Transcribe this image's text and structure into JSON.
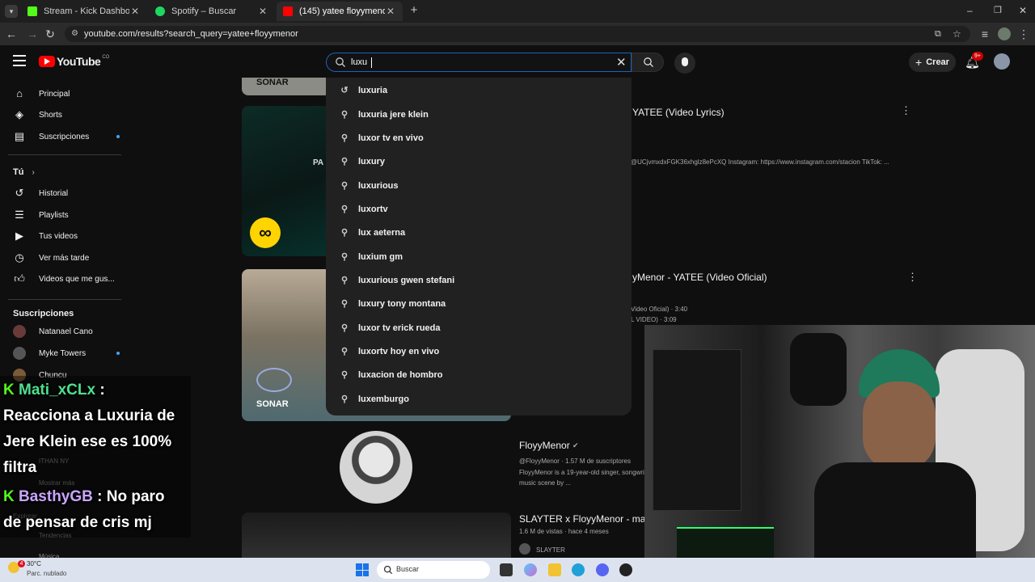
{
  "browser": {
    "tabs": [
      {
        "title": "Stream - Kick Dashboard",
        "icon": "kick-icon",
        "active": false
      },
      {
        "title": "Spotify – Buscar",
        "icon": "spotify-icon",
        "active": false
      },
      {
        "title": "(145) yatee floyymenor - YouTube",
        "icon": "youtube-icon",
        "active": true
      }
    ],
    "new_tab_symbol": "+",
    "url": "youtube.com/results?search_query=yatee+floyymenor"
  },
  "youtube": {
    "logo_text": "YouTube",
    "logo_region": "CO",
    "search_value": "luxu",
    "create_label": "Crear",
    "notification_count": "9+",
    "suggestions": [
      {
        "text": "luxuria",
        "icon": "history-icon"
      },
      {
        "text": "luxuria jere klein",
        "icon": "search-icon"
      },
      {
        "text": "luxor tv en vivo",
        "icon": "search-icon"
      },
      {
        "text": "luxury",
        "icon": "search-icon"
      },
      {
        "text": "luxurious",
        "icon": "search-icon"
      },
      {
        "text": "luxortv",
        "icon": "search-icon"
      },
      {
        "text": "lux aeterna",
        "icon": "search-icon"
      },
      {
        "text": "luxium gm",
        "icon": "search-icon"
      },
      {
        "text": "luxurious gwen stefani",
        "icon": "search-icon"
      },
      {
        "text": "luxury tony montana",
        "icon": "search-icon"
      },
      {
        "text": "luxor tv erick rueda",
        "icon": "search-icon"
      },
      {
        "text": "luxortv hoy en vivo",
        "icon": "search-icon"
      },
      {
        "text": "luxacion de hombro",
        "icon": "search-icon"
      },
      {
        "text": "luxemburgo",
        "icon": "search-icon"
      }
    ]
  },
  "sidebar": {
    "main": [
      {
        "label": "Principal",
        "icon": "home-icon"
      },
      {
        "label": "Shorts",
        "icon": "shorts-icon"
      },
      {
        "label": "Suscripciones",
        "icon": "subscriptions-icon"
      }
    ],
    "you_label": "Tú",
    "you_items": [
      {
        "label": "Historial",
        "icon": "history-icon"
      },
      {
        "label": "Playlists",
        "icon": "playlists-icon"
      },
      {
        "label": "Tus videos",
        "icon": "your-videos-icon"
      },
      {
        "label": "Ver más tarde",
        "icon": "watch-later-icon"
      },
      {
        "label": "Videos que me gus...",
        "icon": "like-icon"
      }
    ],
    "subs_label": "Suscripciones",
    "subs": [
      {
        "label": "Natanael Cano"
      },
      {
        "label": "Myke Towers"
      },
      {
        "label": "Chuncu"
      }
    ],
    "faded": [
      "ITHAN NY",
      "Mostrar más",
      "Explorar",
      "Tendencias",
      "Música"
    ]
  },
  "results": {
    "thumb1_label": "SONAR",
    "thumb2_label": "PA",
    "thumb3_label": "SONAR",
    "video1_title": "YATEE (Video Lyrics)",
    "video1_desc": "@UCjvmxdxFGK36xhglz8ePcXQ Instagram: https://www.instagram.com/stacion TikTok: ...",
    "video2_title": "yMenor - YATEE (Video Oficial)",
    "video2_meta1": "Video Oficial) · 3:40",
    "video2_meta2": "L VIDEO) · 3:09",
    "channel_name": "FloyyMenor",
    "channel_handle": "@FloyyMenor · 1.57 M de suscriptores",
    "channel_desc1": "FloyyMenor is a 19-year-old singer, songwri",
    "channel_desc2": "music scene by ...",
    "video3_title": "SLAYTER x FloyyMenor - mar",
    "video3_meta": "1.6 M de vistas · hace 4 meses",
    "video3_channel": "SLAYTER"
  },
  "chat": {
    "msg1_user": "Mati_xCLx",
    "msg1_sep": ":",
    "msg1_line1": "Reacciona a Luxuria de",
    "msg1_line2": "Jere Klein ese es 100%",
    "msg1_line3": "filtra",
    "msg2_user": "BasthyGB",
    "msg2_text1": ": No paro",
    "msg2_text2": "de pensar de cris mj",
    "badge": "K"
  },
  "taskbar": {
    "weather_temp": "30°C",
    "weather_desc": "Parc. nublado",
    "search_label": "Buscar",
    "weather_badge": "4"
  },
  "colors": {
    "yt_red": "#ff0000",
    "kick_green": "#53fc18",
    "link_blue": "#3ea6ff",
    "chat_user1": "#4ee08c",
    "chat_user2": "#c9a6ff"
  }
}
